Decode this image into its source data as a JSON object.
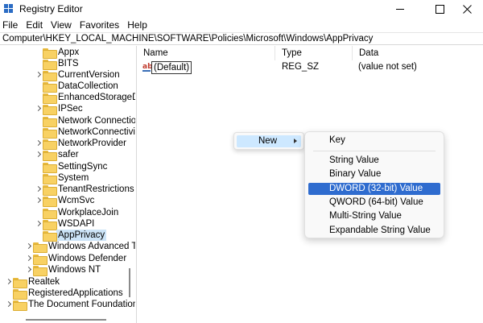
{
  "window": {
    "title": "Registry Editor"
  },
  "menubar": [
    "File",
    "Edit",
    "View",
    "Favorites",
    "Help"
  ],
  "address": "Computer\\HKEY_LOCAL_MACHINE\\SOFTWARE\\Policies\\Microsoft\\Windows\\AppPrivacy",
  "tree": {
    "items": [
      {
        "label": "Appx",
        "expander": false
      },
      {
        "label": "BITS",
        "expander": false
      },
      {
        "label": "CurrentVersion",
        "expander": true
      },
      {
        "label": "DataCollection",
        "expander": false
      },
      {
        "label": "EnhancedStorageDe",
        "expander": false
      },
      {
        "label": "IPSec",
        "expander": true
      },
      {
        "label": "Network Connectio",
        "expander": false
      },
      {
        "label": "NetworkConnectivi",
        "expander": false
      },
      {
        "label": "NetworkProvider",
        "expander": true
      },
      {
        "label": "safer",
        "expander": true
      },
      {
        "label": "SettingSync",
        "expander": false
      },
      {
        "label": "System",
        "expander": false
      },
      {
        "label": "TenantRestrictions",
        "expander": true
      },
      {
        "label": "WcmSvc",
        "expander": true
      },
      {
        "label": "WorkplaceJoin",
        "expander": false
      },
      {
        "label": "WSDAPI",
        "expander": true
      },
      {
        "label": "AppPrivacy",
        "expander": false,
        "selected": true
      },
      {
        "label": "Windows Advanced Th",
        "expander": true
      },
      {
        "label": "Windows Defender",
        "expander": true
      },
      {
        "label": "Windows NT",
        "expander": true
      },
      {
        "label": "Realtek",
        "expander": true
      },
      {
        "label": "RegisteredApplications",
        "expander": false
      },
      {
        "label": "The Document Foundation",
        "expander": true
      }
    ]
  },
  "list": {
    "columns": [
      "Name",
      "Type",
      "Data"
    ],
    "rows": [
      {
        "icon": "string-value-icon",
        "icon_text": "ab",
        "name": "(Default)",
        "type": "REG_SZ",
        "data": "(value not set)"
      }
    ]
  },
  "context_menu": {
    "item": "New"
  },
  "submenu": {
    "items": [
      "Key",
      "String Value",
      "Binary Value",
      "DWORD (32-bit) Value",
      "QWORD (64-bit) Value",
      "Multi-String Value",
      "Expandable String Value"
    ],
    "highlighted": "DWORD (32-bit) Value"
  },
  "colors": {
    "highlight": "#2f6ccf",
    "selection": "#cce4f7",
    "folder": "#f8d163"
  }
}
